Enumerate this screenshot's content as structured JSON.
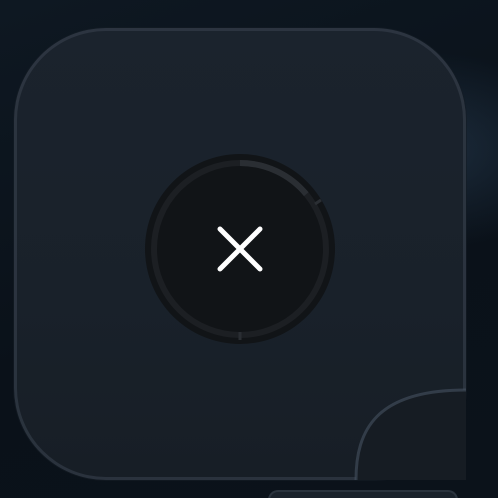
{
  "widget": {
    "icon": "close-icon",
    "progress": 0.14,
    "accent_color": "#ffffff",
    "button_color": "#111417",
    "ring_track_color": "#1c1f23",
    "ring_progress_color": "#2a2e33"
  }
}
